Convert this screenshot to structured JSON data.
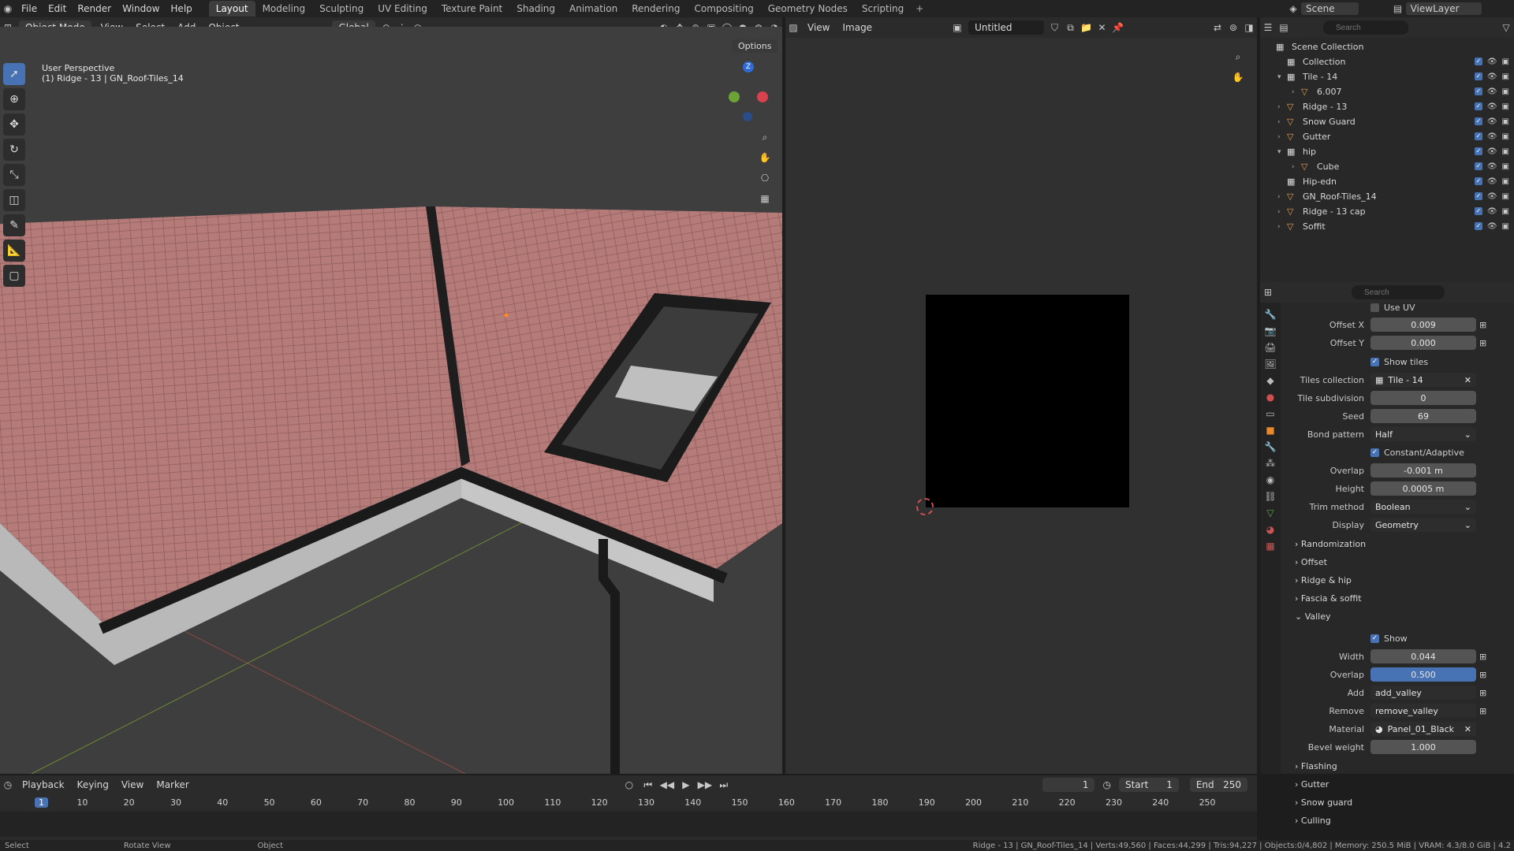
{
  "menubar": {
    "menus": [
      "File",
      "Edit",
      "Render",
      "Window",
      "Help"
    ],
    "workspaces": [
      "Layout",
      "Modeling",
      "Sculpting",
      "UV Editing",
      "Texture Paint",
      "Shading",
      "Animation",
      "Rendering",
      "Compositing",
      "Geometry Nodes",
      "Scripting"
    ],
    "active_workspace": "Layout",
    "add_tab": "+",
    "scene": "Scene",
    "view_layer": "ViewLayer"
  },
  "viewport": {
    "mode": "Object Mode",
    "menus": [
      "View",
      "Select",
      "Add",
      "Object"
    ],
    "transform": "Global",
    "options": "Options",
    "overlay_line1": "User Perspective",
    "overlay_line2": "(1) Ridge - 13 | GN_Roof-Tiles_14",
    "gizmo_z": "Z",
    "roof_color": "#b57b79"
  },
  "image_editor": {
    "menus": [
      "View",
      "Image"
    ],
    "image_name": "Untitled"
  },
  "outliner": {
    "search_placeholder": "Search",
    "root": "Scene Collection",
    "items": [
      {
        "label": "Collection",
        "indent": 0,
        "expand": ""
      },
      {
        "label": "Tile - 14",
        "indent": 0,
        "expand": "▾"
      },
      {
        "label": "6.007",
        "indent": 1,
        "expand": "›"
      },
      {
        "label": "Ridge - 13",
        "indent": 0,
        "expand": "›"
      },
      {
        "label": "Snow Guard",
        "indent": 0,
        "expand": "›"
      },
      {
        "label": "Gutter",
        "indent": 0,
        "expand": "›"
      },
      {
        "label": "hip",
        "indent": 0,
        "expand": "▾"
      },
      {
        "label": "Cube",
        "indent": 1,
        "expand": "›"
      },
      {
        "label": "Hip-edn",
        "indent": 0,
        "expand": ""
      },
      {
        "label": "GN_Roof-Tiles_14",
        "indent": 0,
        "expand": "›"
      },
      {
        "label": "Ridge - 13 cap",
        "indent": 0,
        "expand": "›"
      },
      {
        "label": "Soffit",
        "indent": 0,
        "expand": "›"
      }
    ]
  },
  "properties": {
    "search_placeholder": "Search",
    "use_uv": "Use UV",
    "offset_x_label": "Offset X",
    "offset_x": "0.009",
    "offset_y_label": "Offset Y",
    "offset_y": "0.000",
    "show_tiles": "Show tiles",
    "tiles_collection_label": "Tiles collection",
    "tiles_collection": "Tile - 14",
    "tile_subdivision_label": "Tile subdivision",
    "tile_subdivision": "0",
    "seed_label": "Seed",
    "seed": "69",
    "bond_pattern_label": "Bond pattern",
    "bond_pattern": "Half",
    "constant_adaptive": "Constant/Adaptive",
    "overlap_label": "Overlap",
    "overlap": "-0.001 m",
    "height_label": "Height",
    "height": "0.0005 m",
    "trim_method_label": "Trim method",
    "trim_method": "Boolean",
    "display_label": "Display",
    "display": "Geometry",
    "sections": [
      "Randomization",
      "Offset",
      "Ridge & hip",
      "Fascia & soffit"
    ],
    "valley": "Valley",
    "valley_show": "Show",
    "width_label": "Width",
    "width": "0.044",
    "valley_overlap_label": "Overlap",
    "valley_overlap": "0.500",
    "add_label": "Add",
    "add": "add_valley",
    "remove_label": "Remove",
    "remove": "remove_valley",
    "material_label": "Material",
    "material": "Panel_01_Black",
    "bevel_label": "Bevel weight",
    "bevel": "1.000",
    "sections2": [
      "Flashing",
      "Gutter",
      "Snow guard",
      "Culling"
    ]
  },
  "timeline": {
    "menus": [
      "Playback",
      "Keying",
      "View",
      "Marker"
    ],
    "current_frame": "1",
    "start_label": "Start",
    "start": "1",
    "end_label": "End",
    "end": "250",
    "ticks": [
      "1",
      "10",
      "20",
      "30",
      "40",
      "50",
      "60",
      "70",
      "80",
      "90",
      "100",
      "110",
      "120",
      "130",
      "140",
      "150",
      "160",
      "170",
      "180",
      "190",
      "200",
      "210",
      "220",
      "230",
      "240",
      "250"
    ]
  },
  "statusbar": {
    "left": [
      "Select",
      "Rotate View",
      "Object"
    ],
    "right": "Ridge - 13 | GN_Roof-Tiles_14 | Verts:49,560 | Faces:44,299 | Tris:94,227 | Objects:0/4,802 | Memory: 250.5 MiB | VRAM: 4.3/8.0 GiB | 4.2"
  }
}
